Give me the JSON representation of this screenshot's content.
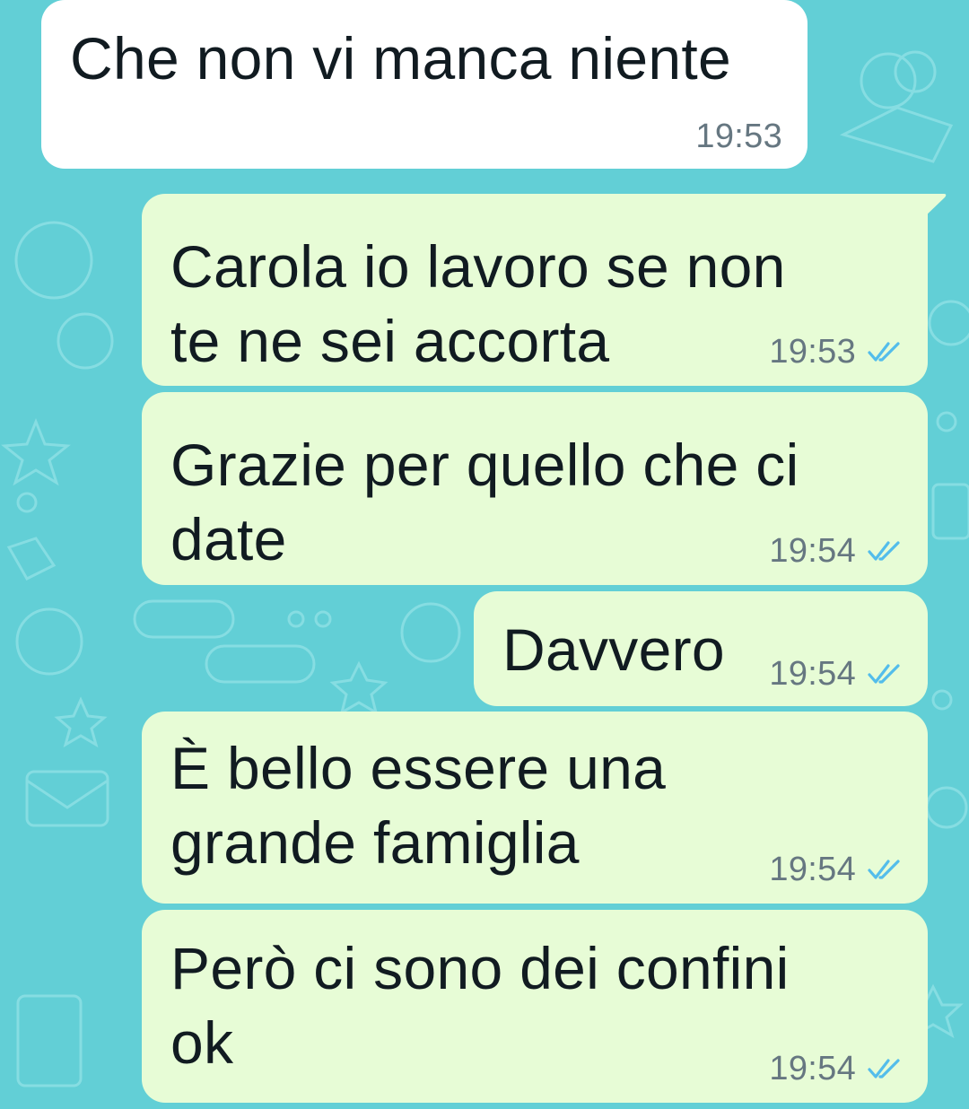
{
  "theme": {
    "wallpaper_color": "#62cfd6",
    "incoming_bubble_color": "#ffffff",
    "outgoing_bubble_color": "#e7fcd6",
    "read_tick_color": "#53bdeb",
    "timestamp_color": "#667781"
  },
  "messages": [
    {
      "direction": "incoming",
      "text": "Che non vi manca niente",
      "time": "19:53",
      "status": ""
    },
    {
      "direction": "outgoing",
      "text": "Carola io lavoro se non\nte ne sei accorta",
      "time": "19:53",
      "status": "read"
    },
    {
      "direction": "outgoing",
      "text": "Grazie per quello che ci\ndate",
      "time": "19:54",
      "status": "read"
    },
    {
      "direction": "outgoing",
      "text": "Davvero",
      "time": "19:54",
      "status": "read"
    },
    {
      "direction": "outgoing",
      "text": "È bello essere una\ngrande famiglia",
      "time": "19:54",
      "status": "read"
    },
    {
      "direction": "outgoing",
      "text": "Però ci sono dei confini\nok",
      "time": "19:54",
      "status": "read"
    }
  ]
}
